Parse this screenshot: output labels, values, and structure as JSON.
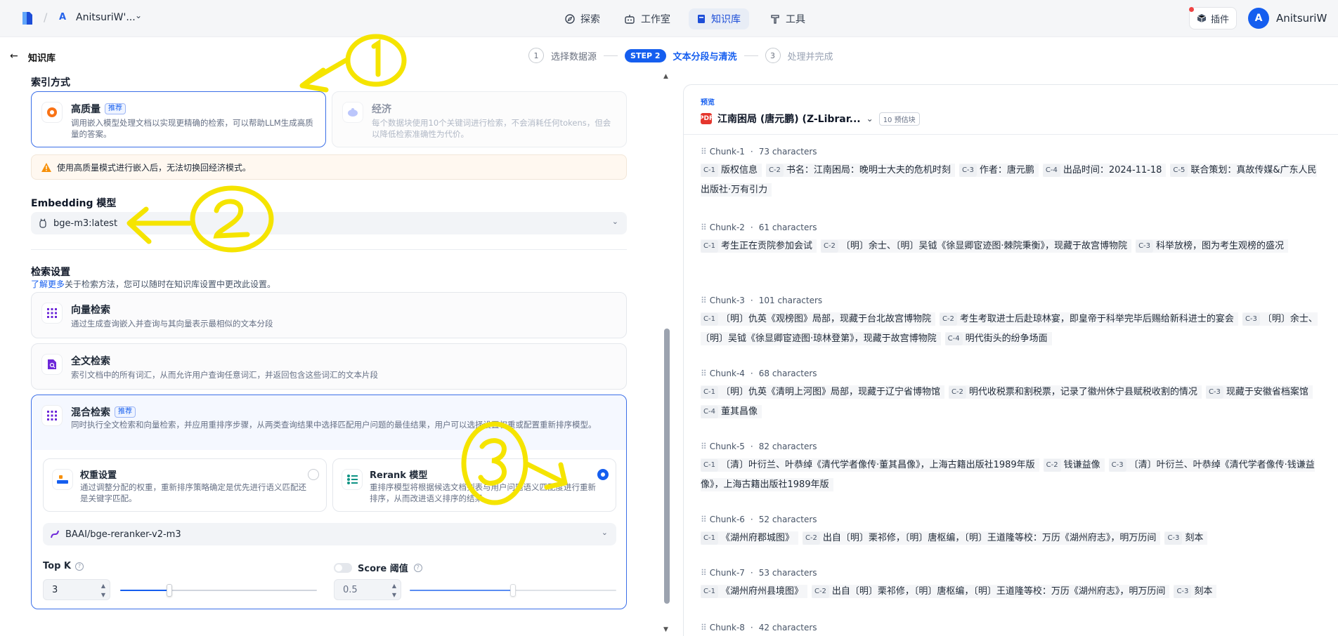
{
  "topnav": {
    "workspace_initial": "A",
    "workspace_name": "AnitsuriW'...",
    "items": [
      {
        "label": "探索"
      },
      {
        "label": "工作室"
      },
      {
        "label": "知识库"
      },
      {
        "label": "工具"
      }
    ],
    "plugin_label": "插件",
    "user_initial": "A",
    "user_name": "AnitsuriW"
  },
  "header": {
    "back_label": "知识库",
    "steps": [
      {
        "num": "1",
        "label": "选择数据源"
      },
      {
        "badge": "STEP 2",
        "label": "文本分段与清洗"
      },
      {
        "num": "3",
        "label": "处理并完成"
      }
    ]
  },
  "index": {
    "title": "索引方式",
    "high": {
      "title": "高质量",
      "tag": "推荐",
      "desc": "调用嵌入模型处理文档以实现更精确的检索，可以帮助LLM生成高质量的答案。"
    },
    "econ": {
      "title": "经济",
      "desc": "每个数据块使用10个关键词进行检索，不会消耗任何tokens，但会以降低检索准确性为代价。"
    },
    "warning": "使用高质量模式进行嵌入后，无法切换回经济模式。"
  },
  "embedding": {
    "title": "Embedding 模型",
    "model": "bge-m3:latest"
  },
  "retrieval": {
    "title": "检索设置",
    "learn_more": "了解更多",
    "hint": "关于检索方法，您可以随时在知识库设置中更改此设置。",
    "vector": {
      "title": "向量检索",
      "desc": "通过生成查询嵌入并查询与其向量表示最相似的文本分段"
    },
    "fulltext": {
      "title": "全文检索",
      "desc": "索引文档中的所有词汇，从而允许用户查询任意词汇，并返回包含这些词汇的文本片段"
    },
    "hybrid": {
      "title": "混合检索",
      "tag": "推荐",
      "desc": "同时执行全文检索和向量检索，并应用重排序步骤，从两类查询结果中选择匹配用户问题的最佳结果，用户可以选择设置权重或配置重新排序模型。"
    },
    "weight": {
      "title": "权重设置",
      "desc": "通过调整分配的权重，重新排序策略确定是优先进行语义匹配还是关键字匹配。"
    },
    "rerank": {
      "title": "Rerank 模型",
      "desc": "重排序模型将根据候选文档列表与用户问题语义匹配度进行重新排序，从而改进语义排序的结果"
    },
    "rerank_model": "BAAI/bge-reranker-v2-m3",
    "topk_label": "Top K",
    "topk_value": "3",
    "topk_fraction": 0.25,
    "score_label": "Score 阈值",
    "score_value": "0.5",
    "score_fraction": 0.5,
    "score_enabled": false
  },
  "preview": {
    "label": "预览",
    "doc_name": "江南困局 (唐元鹏) (Z-Librar...",
    "chunk_count": "10 预估块",
    "chunks": [
      {
        "name": "Chunk-1",
        "chars": "73 characters",
        "segs": [
          {
            "tag": "C-1",
            "text": "版权信息"
          },
          {
            "tag": "C-2",
            "text": "书名：江南困局：晚明士大夫的危机时刻"
          },
          {
            "tag": "C-3",
            "text": "作者：唐元鹏"
          },
          {
            "tag": "C-4",
            "text": "出品时间：2024-11-18"
          },
          {
            "tag": "C-5",
            "text": "联合策划：真故传媒&广东人民出版社·万有引力"
          }
        ]
      },
      {
        "name": "Chunk-2",
        "chars": "61 characters",
        "segs": [
          {
            "tag": "C-1",
            "text": "考生正在贡院参加会试"
          },
          {
            "tag": "C-2",
            "text": "〔明〕余士、〔明〕吴钺《徐显卿宦迹图·棘院秉衡》，现藏于故宫博物院"
          },
          {
            "tag": "C-3",
            "text": "科举放榜，图为考生观榜的盛况"
          }
        ]
      },
      {
        "name": "Chunk-3",
        "chars": "101 characters",
        "segs": [
          {
            "tag": "C-1",
            "text": "〔明〕仇英《观榜图》局部，现藏于台北故宫博物院"
          },
          {
            "tag": "C-2",
            "text": "考生考取进士后赴琼林宴，即皇帝于科举完毕后赐给新科进士的宴会"
          },
          {
            "tag": "C-3",
            "text": "〔明〕余士、〔明〕吴钺《徐显卿宦迹图·琼林登第》，现藏于故宫博物院"
          },
          {
            "tag": "C-4",
            "text": "明代街头的纷争场面"
          }
        ]
      },
      {
        "name": "Chunk-4",
        "chars": "68 characters",
        "segs": [
          {
            "tag": "C-1",
            "text": "〔明〕仇英《清明上河图》局部，现藏于辽宁省博物馆"
          },
          {
            "tag": "C-2",
            "text": "明代收税票和割税票，记录了徽州休宁县赋税收割的情况"
          },
          {
            "tag": "C-3",
            "text": "现藏于安徽省档案馆"
          },
          {
            "tag": "C-4",
            "text": "董其昌像"
          }
        ]
      },
      {
        "name": "Chunk-5",
        "chars": "82 characters",
        "segs": [
          {
            "tag": "C-1",
            "text": "〔清〕叶衍兰、叶恭绰《清代学者像传·董其昌像》，上海古籍出版社1989年版"
          },
          {
            "tag": "C-2",
            "text": "钱谦益像"
          },
          {
            "tag": "C-3",
            "text": "〔清〕叶衍兰、叶恭绰《清代学者像传·钱谦益像》，上海古籍出版社1989年版"
          }
        ]
      },
      {
        "name": "Chunk-6",
        "chars": "52 characters",
        "segs": [
          {
            "tag": "C-1",
            "text": "《湖州府郡城图》"
          },
          {
            "tag": "C-2",
            "text": "出自〔明〕栗祁修，〔明〕唐枢编，〔明〕王道隆等校：万历《湖州府志》，明万历间"
          },
          {
            "tag": "C-3",
            "text": "刻本"
          }
        ]
      },
      {
        "name": "Chunk-7",
        "chars": "53 characters",
        "segs": [
          {
            "tag": "C-1",
            "text": "《湖州府州县境图》"
          },
          {
            "tag": "C-2",
            "text": "出自〔明〕栗祁修，〔明〕唐枢编，〔明〕王道隆等校：万历《湖州府志》，明万历间"
          },
          {
            "tag": "C-3",
            "text": "刻本"
          }
        ]
      },
      {
        "name": "Chunk-8",
        "chars": "42 characters",
        "segs": []
      }
    ]
  },
  "annotations": [
    "1",
    "2",
    "3"
  ],
  "colors": {
    "accent": "#155eef",
    "annotation": "#f5e400",
    "warning": "#f79009"
  }
}
